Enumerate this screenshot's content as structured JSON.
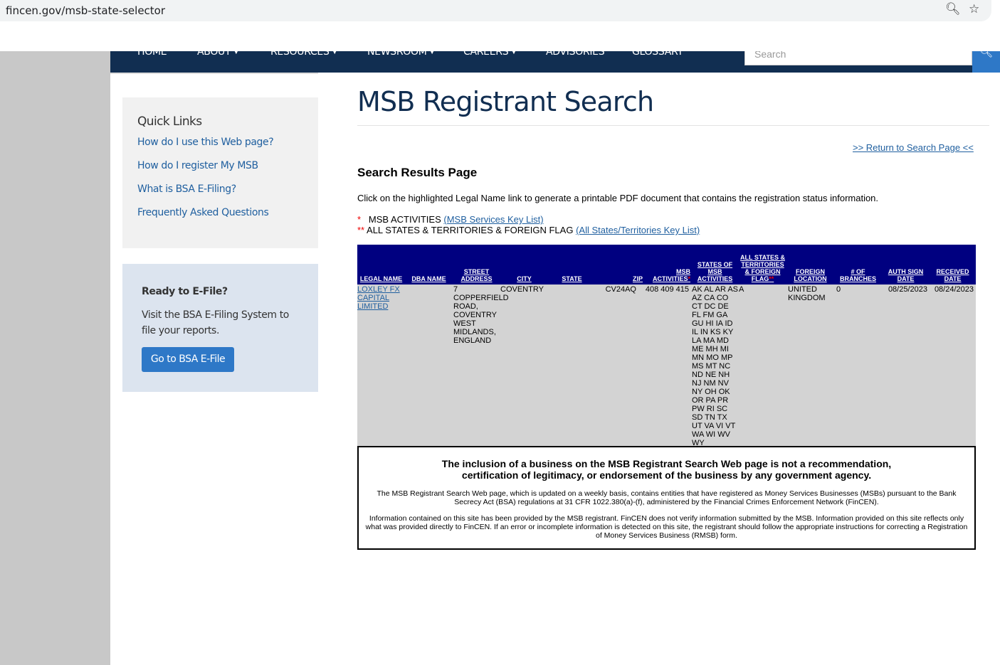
{
  "browser": {
    "url": "fincen.gov/msb-state-selector"
  },
  "nav": {
    "home": "HOME",
    "about": "ABOUT",
    "resources": "RESOURCES",
    "newsroom": "NEWSROOM",
    "careers": "CAREERS",
    "advisories": "ADVISORIES",
    "glossary": "GLOSSARY",
    "search_placeholder": "Search"
  },
  "quick_links": {
    "title": "Quick Links",
    "items": [
      "How do I use this Web page?",
      "How do I register My MSB",
      "What is BSA E-Filing?",
      "Frequently Asked Questions"
    ]
  },
  "efile": {
    "title": "Ready to E-File?",
    "text": "Visit the BSA E-Filing System to file your reports.",
    "button": "Go to BSA E-File"
  },
  "main": {
    "title": "MSB Registrant Search",
    "return_link": ">> Return to Search Page <<",
    "subtitle": "Search Results Page",
    "instruction": "Click on the highlighted Legal Name link to generate a printable PDF document that contains the registration status information.",
    "key1_mark": "*",
    "key1_text": "MSB ACTIVITIES",
    "key1_link": "(MSB Services Key List)",
    "key2_mark": "**",
    "key2_text": "ALL STATES & TERRITORIES & FOREIGN FLAG",
    "key2_link": "(All States/Territories Key List)"
  },
  "table": {
    "headers": {
      "legal_name": "LEGAL NAME",
      "dba_name": "DBA NAME",
      "street_address": "STREET ADDRESS",
      "city": "CITY",
      "state": "STATE",
      "zip": "ZIP",
      "msb_activities": "MSB ACTIVITIES",
      "msb_activities_mark": "*",
      "states_of_msb": "STATES OF MSB ACTIVITIES",
      "all_states": "ALL STATES & TERRITORIES & FOREIGN FLAG",
      "all_states_mark": "**",
      "foreign_location": "FOREIGN LOCATION",
      "branches": "# OF BRANCHES",
      "auth_sign_date": "AUTH SIGN DATE",
      "received_date": "RECEIVED DATE"
    },
    "row": {
      "legal_name": "LOXLEY FX CAPITAL LIMITED",
      "dba_name": "",
      "street_address": "7 COPPERFIELD ROAD, COVENTRY WEST MIDLANDS, ENGLAND",
      "city": "COVENTRY",
      "state": "",
      "zip": "CV24AQ",
      "msb_activities": "408 409 415",
      "states": "AK AL AR AS AZ CA CO CT DC DE FL FM GA GU HI IA ID IL IN KS KY LA MA MD ME MH MI MN MO MP MS MT NC ND NE NH NJ NM NV NY OH OK OR PA PR PW RI SC SD TN TX UT VA VI VT WA WI WV WY",
      "all_states": "A",
      "foreign_location": "UNITED KINGDOM",
      "branches": "0",
      "auth_sign_date": "08/25/2023",
      "received_date": "08/24/2023"
    }
  },
  "disclaimer": {
    "heading": "The inclusion of a business on the MSB Registrant Search Web page is not a recommendation, certification of legitimacy, or endorsement of the business by any government agency.",
    "p1": "The MSB Registrant Search Web page, which is updated on a weekly basis, contains entities that have registered as Money Services Businesses (MSBs) pursuant to the Bank Secrecy Act (BSA) regulations at 31 CFR 1022.380(a)-(f), administered by the Financial Crimes Enforcement Network (FinCEN).",
    "p2": "Information contained on this site has been provided by the MSB registrant. FinCEN does not verify information submitted by the MSB. Information provided on this site reflects only what was provided directly to FinCEN. If an error or incomplete information is detected on this site, the registrant should follow the appropriate instructions for correcting a Registration of Money Services Business (RMSB) form."
  }
}
